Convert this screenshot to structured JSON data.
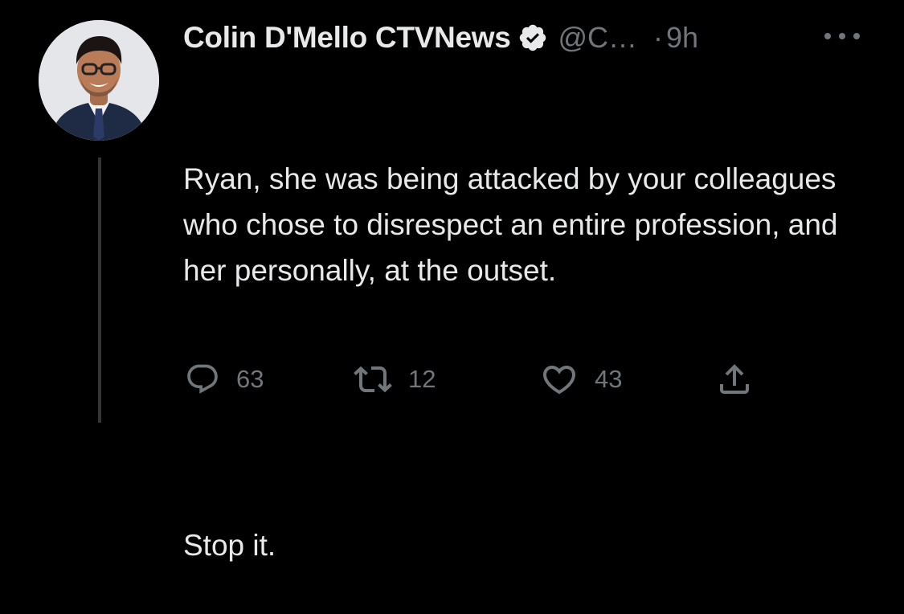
{
  "author": {
    "display_name": "Colin D'Mello CTVNews",
    "handle": "@C…",
    "separator": "·",
    "time": "9h",
    "avatar_icon": "profile-photo",
    "verified_icon": "verified-badge-icon"
  },
  "tweet": {
    "paragraphs": [
      "Ryan, she was being attacked by your colleagues who chose to disrespect an entire profession, and her personally, at the outset.",
      "Stop it."
    ]
  },
  "actions": {
    "reply_count": "63",
    "retweet_count": "12",
    "like_count": "43"
  },
  "colors": {
    "background": "#000000",
    "text": "#e7e9ea",
    "muted": "#71767b",
    "thread_line": "#333639"
  }
}
